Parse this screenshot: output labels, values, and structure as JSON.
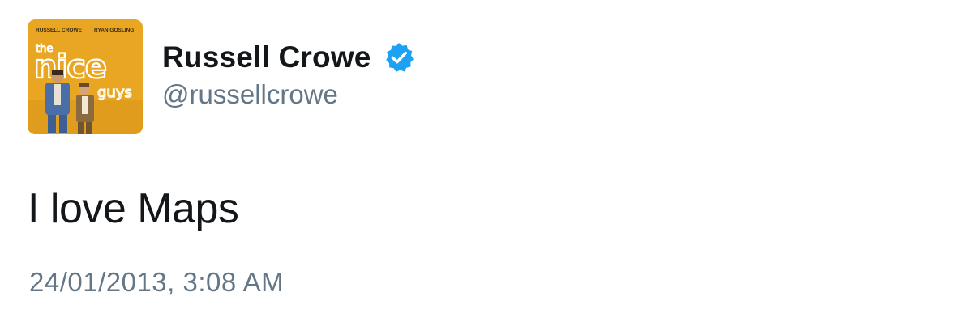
{
  "tweet": {
    "author": {
      "display_name": "Russell Crowe",
      "handle": "@russellcrowe",
      "verified": true,
      "verified_icon": "verified-badge-icon",
      "avatar": {
        "description_icon": "movie-poster-avatar",
        "poster_text_top_left": "RUSSELL CROWE",
        "poster_text_top_right": "RYAN GOSLING",
        "poster_title_small": "the",
        "poster_title_main": "nice",
        "poster_title_tail": "guys",
        "background_color": "#e9a622"
      }
    },
    "text": "I love Maps",
    "timestamp": "24/01/2013, 3:08 AM"
  },
  "colors": {
    "primary_text": "#14171a",
    "secondary_text": "#657786",
    "verified_blue": "#1da1f2",
    "background": "#ffffff"
  }
}
